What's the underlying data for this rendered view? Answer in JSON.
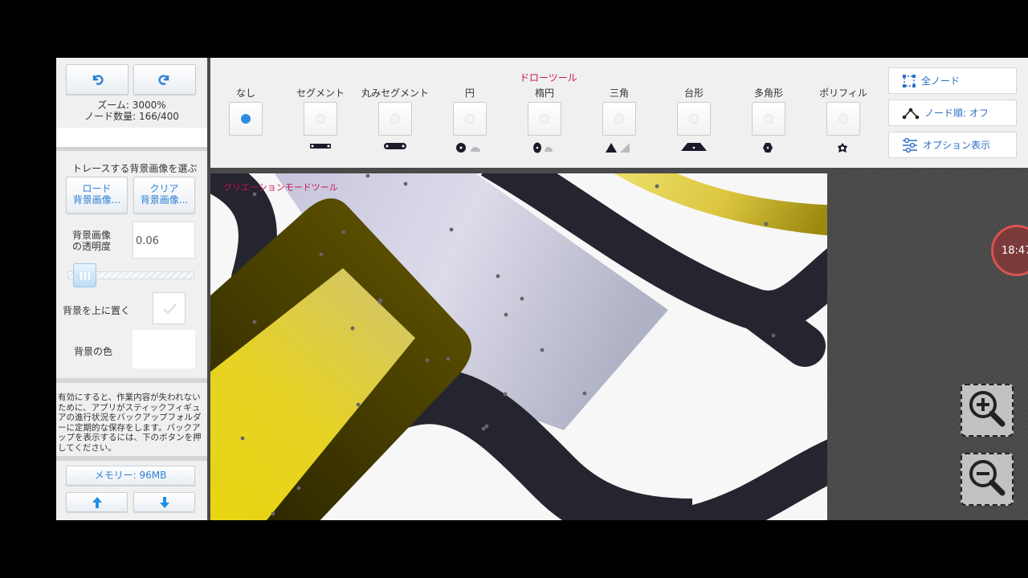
{
  "left_panel": {
    "undo_icon": "undo-icon",
    "redo_icon": "redo-icon",
    "zoom_text": "ズーム: 3000%",
    "node_count_text": "ノード数量: 166/400",
    "trace_title": "トレースする背景画像を選ぶ",
    "load_line1": "ロード",
    "load_line2": "背景画像...",
    "clear_line1": "クリア",
    "clear_line2": "背景画像...",
    "opacity_label_1": "背景画像",
    "opacity_label_2": "の透明度",
    "opacity_value": "0.06",
    "slider_fraction": 0.06,
    "bg_on_top_label": "背景を上に置く",
    "bg_color_label": "背景の色",
    "backup_text": "有効にすると、作業内容が失われないために、アプリがスティックフィギュアの進行状況をバックアップフォルダーに定期的な保存をします。バックアップを表示するには、下のボタンを押してください。",
    "memory_label": "メモリー: 96MB"
  },
  "toolbar": {
    "title": "ドローツール",
    "tools": [
      {
        "label": "なし",
        "selected": true
      },
      {
        "label": "セグメント",
        "selected": false
      },
      {
        "label": "丸みセグメント",
        "selected": false
      },
      {
        "label": "円",
        "selected": false
      },
      {
        "label": "楕円",
        "selected": false
      },
      {
        "label": "三角",
        "selected": false
      },
      {
        "label": "台形",
        "selected": false
      },
      {
        "label": "多角形",
        "selected": false
      },
      {
        "label": "ポリフィル",
        "selected": false
      }
    ],
    "all_nodes_label": "全ノード",
    "node_order_label": "ノード順: オフ",
    "options_label": "オプション表示"
  },
  "canvas": {
    "mode_label": "クリエーションモードツール"
  },
  "overlay": {
    "clock": "18:47"
  },
  "colors": {
    "accent_blue": "#2a7fd6",
    "tool_title_red": "#c8154d",
    "stroke_dark": "#25252f",
    "olive": "#5a4f00",
    "yellow": "#e6d320"
  }
}
